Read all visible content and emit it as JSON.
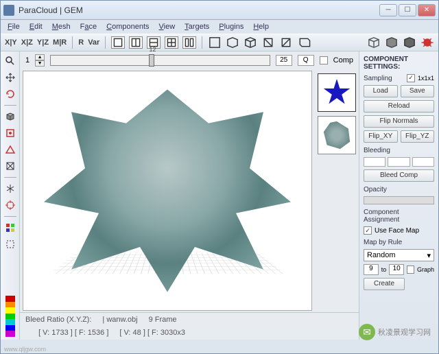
{
  "window": {
    "title": "ParaCloud | GEM"
  },
  "menu": {
    "file": "File",
    "edit": "Edit",
    "mesh": "Mesh",
    "face": "Face",
    "components": "Components",
    "view": "View",
    "targets": "Targets",
    "plugins": "Plugins",
    "help": "Help"
  },
  "toolbar": {
    "xy": "X|Y",
    "xz": "X|Z",
    "yz": "Y|Z",
    "mr": "M|R",
    "r": "R",
    "var": "Var"
  },
  "slider": {
    "min": "1",
    "label": "12",
    "val": "25",
    "step": "Q",
    "comp": "Comp"
  },
  "panel": {
    "title": "COMPONENT SETTINGS:",
    "sampling": "Sampling",
    "sampling_val": "1x1x1",
    "load": "Load",
    "save": "Save",
    "reload": "Reload",
    "flip_normals": "Flip Normals",
    "flip_xy": "Flip_XY",
    "flip_yz": "Flip_YZ",
    "bleeding": "Bleeding",
    "bleed_comp": "Bleed Comp",
    "opacity": "Opacity",
    "comp_assign": "Component Assignment",
    "use_facemap": "Use Face Map",
    "map_rule": "Map by Rule",
    "random": "Random",
    "range_from": "9",
    "range_to_lbl": "to",
    "range_to": "10",
    "graph": "Graph",
    "create": "Create"
  },
  "status": {
    "bleed": "Bleed Ratio (X.Y.Z):",
    "file": "| wanw.obj",
    "dims": "[ V: 1733 ] [ F: 1536 ]",
    "frame": "9  Frame",
    "views": "[ V: 48 ] [ F: 3030x3"
  },
  "watermark": {
    "url": "www.qljgw.com",
    "wechat": "秋凌景观学习网"
  }
}
